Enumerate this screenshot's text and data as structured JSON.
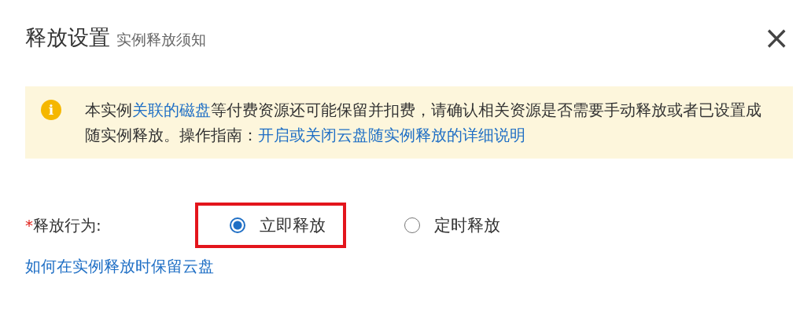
{
  "dialog": {
    "title": "释放设置",
    "subtitle": "实例释放须知",
    "close": "×"
  },
  "notice": {
    "icon": "i",
    "parts": [
      {
        "kind": "text",
        "text": "本实例"
      },
      {
        "kind": "link",
        "text": "关联的磁盘"
      },
      {
        "kind": "text",
        "text": "等付费资源还可能保留并扣费，请确认相关资源是否需要手动释放或者已设置成随实例释放。操作指南："
      },
      {
        "kind": "link",
        "text": "开启或关闭云盘随实例释放的详细说明"
      }
    ]
  },
  "release_action": {
    "required_mark": "*",
    "label": "释放行为:",
    "options": [
      {
        "label": "立即释放",
        "selected": true,
        "highlighted": true
      },
      {
        "label": "定时释放",
        "selected": false,
        "highlighted": false
      }
    ]
  },
  "help_link": "如何在实例释放时保留云盘"
}
